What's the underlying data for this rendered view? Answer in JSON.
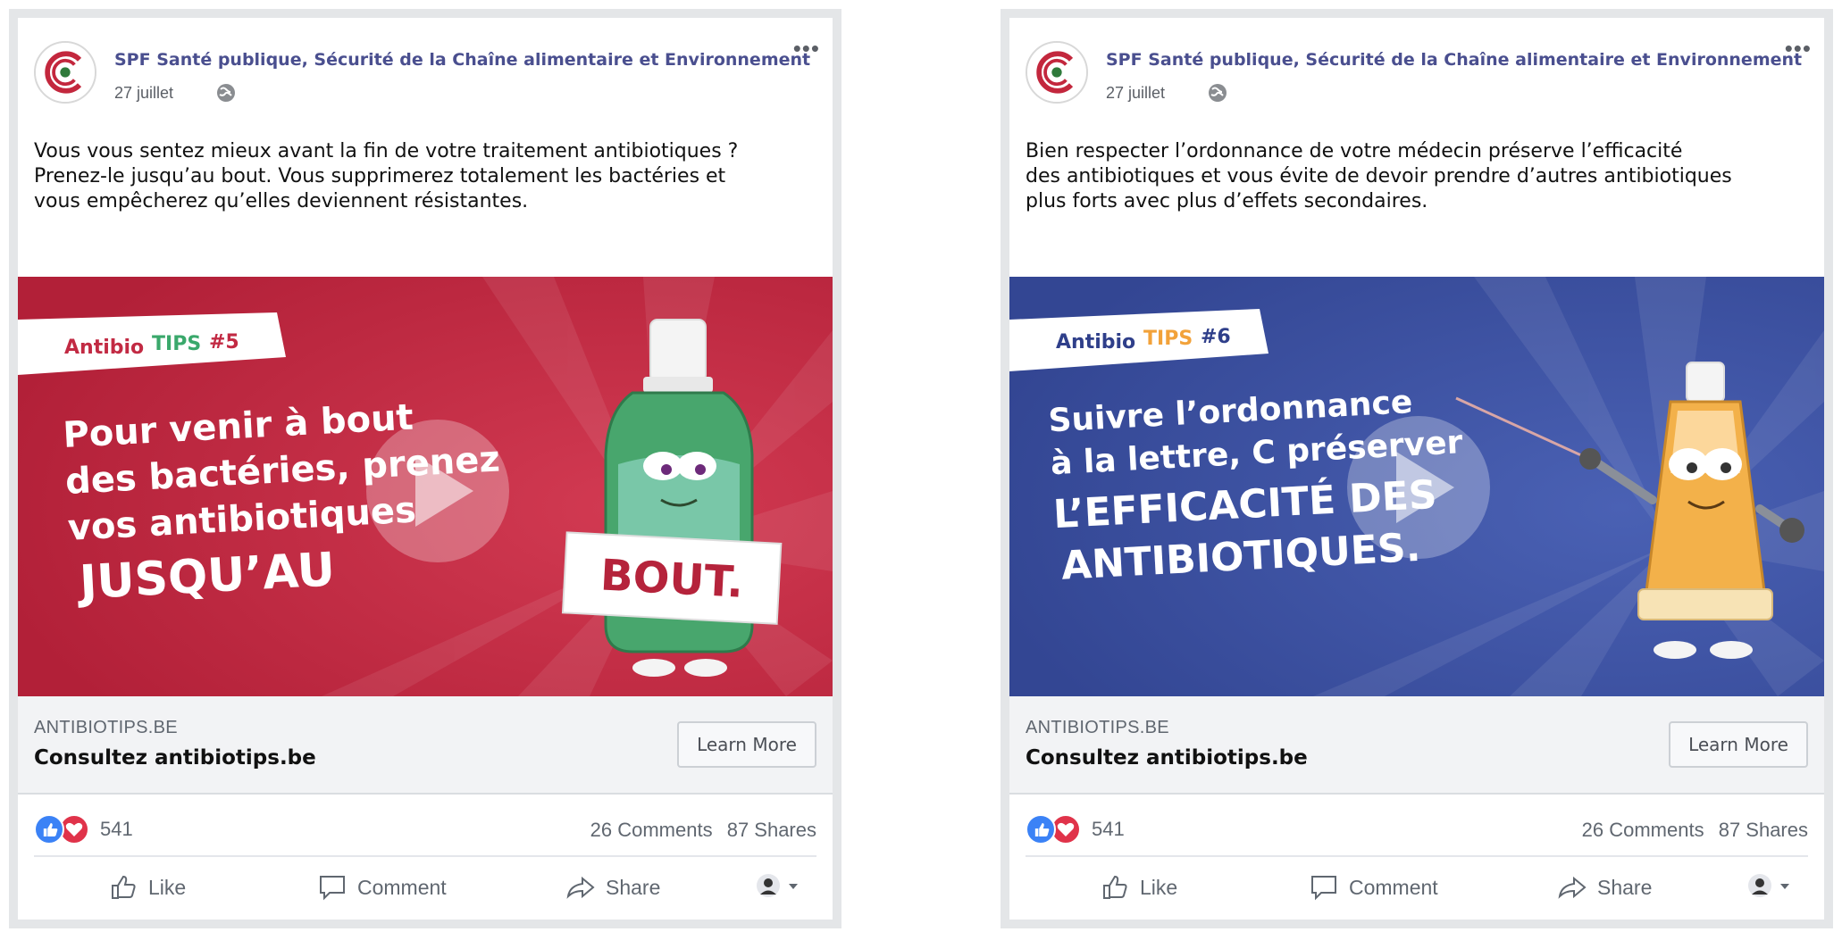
{
  "posts": [
    {
      "page_name": "SPF Santé publique, Sécurité de la Chaîne alimentaire et Environnement",
      "date": "27 juillet",
      "text_lines": [
        "Vous vous sentez mieux avant la fin de votre traitement antibiotiques ?",
        "Prenez-le jusqu’au bout. Vous supprimerez totalement les bactéries et",
        "vous empêcherez qu’elles deviennent résistantes."
      ],
      "media": {
        "tag_prefix": "Antibio",
        "tag_tips": "TIPS",
        "tag_number": "#5",
        "headline_lines": [
          "Pour venir à bout",
          "des bactéries, prenez",
          "vos antibiotiques",
          "JUSQU’AU"
        ],
        "sign_text": "BOUT.",
        "background_color": "#c22a43",
        "tips_color": "#3aa86b"
      },
      "link": {
        "domain": "ANTIBIOTIPS.BE",
        "title": "Consultez antibiotips.be",
        "button": "Learn More"
      },
      "stats": {
        "reaction_count": "541",
        "comments": "26 Comments",
        "shares": "87 Shares"
      },
      "actions": {
        "like": "Like",
        "comment": "Comment",
        "share": "Share"
      }
    },
    {
      "page_name": "SPF Santé publique, Sécurité de la Chaîne alimentaire et Environnement",
      "date": "27 juillet",
      "text_lines": [
        "Bien respecter l’ordonnance de votre médecin préserve l’efficacité",
        "des antibiotiques et vous évite de devoir prendre d’autres antibiotiques",
        "plus forts avec plus d’effets secondaires."
      ],
      "media": {
        "tag_prefix": "Antibio",
        "tag_tips": "TIPS",
        "tag_number": "#6",
        "headline_lines": [
          "Suivre l’ordonnance",
          "à la lettre, C préserver",
          "L’EFFICACITÉ DES",
          "ANTIBIOTIQUES."
        ],
        "background_color": "#3a4fa0",
        "tips_color": "#f2a23a"
      },
      "link": {
        "domain": "ANTIBIOTIPS.BE",
        "title": "Consultez antibiotips.be",
        "button": "Learn More"
      },
      "stats": {
        "reaction_count": "541",
        "comments": "26 Comments",
        "shares": "87 Shares"
      },
      "actions": {
        "like": "Like",
        "comment": "Comment",
        "share": "Share"
      }
    }
  ],
  "icons": {
    "more": "more-options-icon",
    "globe": "globe-icon",
    "like": "thumbs-up-icon",
    "love": "heart-icon",
    "comment": "comment-bubble-icon",
    "share": "share-arrow-icon",
    "audience": "person-icon",
    "play": "play-icon"
  }
}
